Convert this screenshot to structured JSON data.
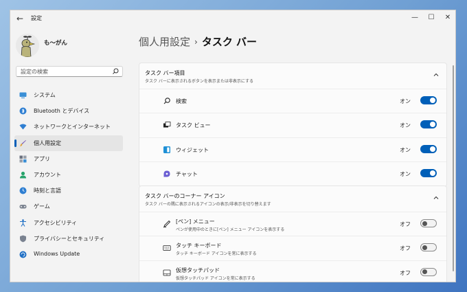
{
  "window": {
    "title": "設定",
    "minimize": "—",
    "maximize": "☐",
    "close": "✕"
  },
  "sidebar": {
    "username": "も～がん",
    "search_placeholder": "設定の検索",
    "items": [
      {
        "label": "システム",
        "icon": "system-monitor-icon"
      },
      {
        "label": "Bluetooth とデバイス",
        "icon": "bluetooth-icon"
      },
      {
        "label": "ネットワークとインターネット",
        "icon": "network-icon"
      },
      {
        "label": "個人用設定",
        "icon": "paintbrush-icon",
        "active": true
      },
      {
        "label": "アプリ",
        "icon": "apps-icon"
      },
      {
        "label": "アカウント",
        "icon": "account-icon"
      },
      {
        "label": "時刻と言語",
        "icon": "time-language-icon"
      },
      {
        "label": "ゲーム",
        "icon": "gamepad-icon"
      },
      {
        "label": "アクセシビリティ",
        "icon": "accessibility-icon"
      },
      {
        "label": "プライバシーとセキュリティ",
        "icon": "shield-icon"
      },
      {
        "label": "Windows Update",
        "icon": "windows-update-icon"
      }
    ]
  },
  "breadcrumb": {
    "parent": "個人用設定",
    "separator": "›",
    "current": "タスク バー"
  },
  "sections": [
    {
      "title": "タスク バー項目",
      "subtitle": "タスク バーに表示されるボタンを表示または非表示にする",
      "rows": [
        {
          "label": "検索",
          "state": "オン",
          "on": true,
          "icon": "search-icon"
        },
        {
          "label": "タスク ビュー",
          "state": "オン",
          "on": true,
          "icon": "task-view-icon"
        },
        {
          "label": "ウィジェット",
          "state": "オン",
          "on": true,
          "icon": "widgets-icon"
        },
        {
          "label": "チャット",
          "state": "オン",
          "on": true,
          "icon": "chat-icon"
        }
      ]
    },
    {
      "title": "タスク バーのコーナー アイコン",
      "subtitle": "タスク バーの隅に表示されるアイコンの表示/非表示を切り替えます",
      "rows": [
        {
          "label": "[ペン] メニュー",
          "sub": "ペンが使用中のときに[ペン] メニュー アイコンを表示する",
          "state": "オフ",
          "on": false,
          "icon": "pen-icon"
        },
        {
          "label": "タッチ キーボード",
          "sub": "タッチ キーボード アイコンを常に表示する",
          "state": "オフ",
          "on": false,
          "icon": "keyboard-icon"
        },
        {
          "label": "仮想タッチパッド",
          "sub": "仮想タッチパッド アイコンを常に表示する",
          "state": "オフ",
          "on": false,
          "icon": "touchpad-icon"
        }
      ]
    }
  ],
  "colors": {
    "accent": "#005fb8",
    "background": "#f3f3f3",
    "card": "#fbfbfb"
  }
}
